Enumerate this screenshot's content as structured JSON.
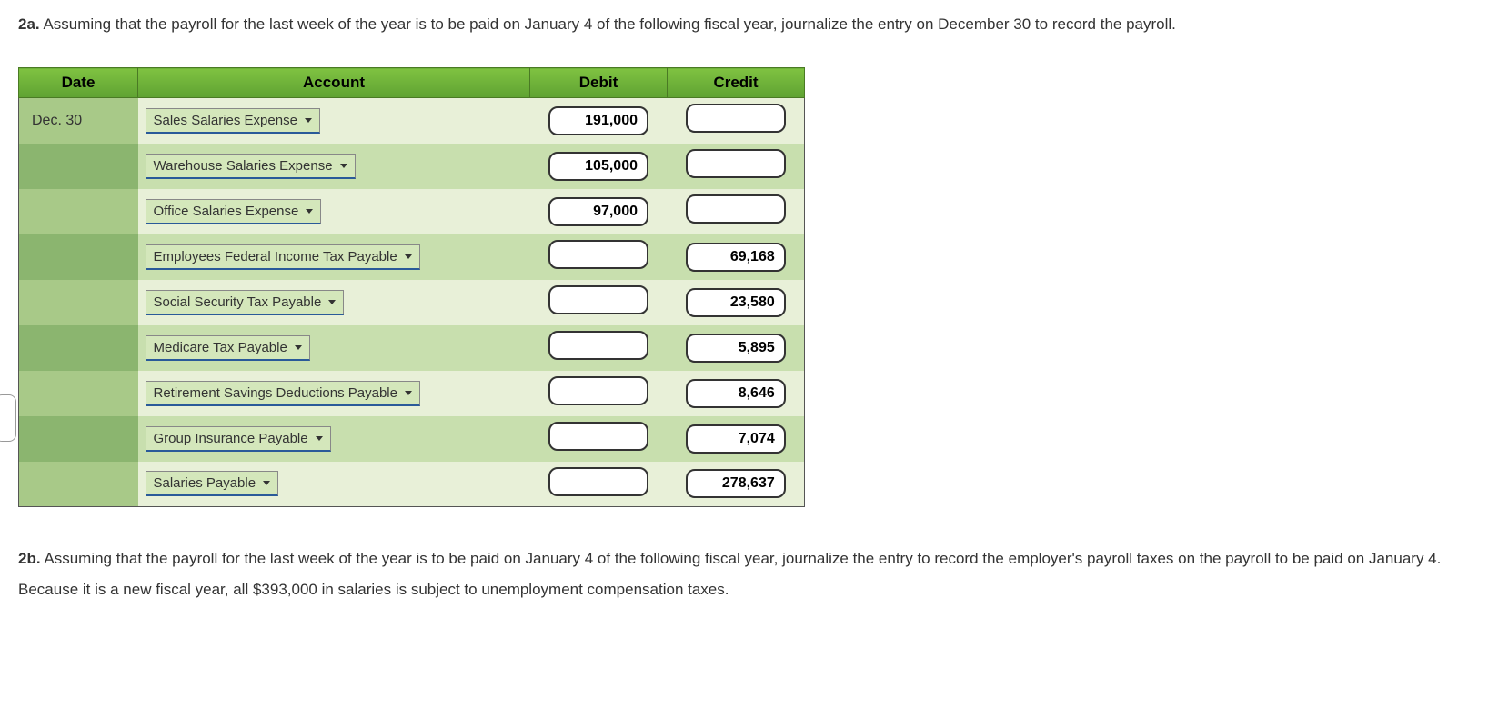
{
  "question2a": {
    "label": "2a.",
    "text": "Assuming that the payroll for the last week of the year is to be paid on January 4 of the following fiscal year, journalize the entry on December 30 to record the payroll."
  },
  "table": {
    "headers": {
      "date": "Date",
      "account": "Account",
      "debit": "Debit",
      "credit": "Credit"
    },
    "rows": [
      {
        "date": "Dec. 30",
        "account": "Sales Salaries Expense",
        "debit": "191,000",
        "credit": ""
      },
      {
        "date": "",
        "account": "Warehouse Salaries Expense",
        "debit": "105,000",
        "credit": ""
      },
      {
        "date": "",
        "account": "Office Salaries Expense",
        "debit": "97,000",
        "credit": ""
      },
      {
        "date": "",
        "account": "Employees Federal Income Tax Payable",
        "debit": "",
        "credit": "69,168"
      },
      {
        "date": "",
        "account": "Social Security Tax Payable",
        "debit": "",
        "credit": "23,580"
      },
      {
        "date": "",
        "account": "Medicare Tax Payable",
        "debit": "",
        "credit": "5,895"
      },
      {
        "date": "",
        "account": "Retirement Savings Deductions Payable",
        "debit": "",
        "credit": "8,646"
      },
      {
        "date": "",
        "account": "Group Insurance Payable",
        "debit": "",
        "credit": "7,074"
      },
      {
        "date": "",
        "account": "Salaries Payable",
        "debit": "",
        "credit": "278,637"
      }
    ]
  },
  "question2b": {
    "label": "2b.",
    "text": "Assuming that the payroll for the last week of the year is to be paid on January 4 of the following fiscal year, journalize the entry to record the employer's payroll taxes on the payroll to be paid on January 4. Because it is a new fiscal year, all $393,000 in salaries is subject to unemployment compensation taxes."
  }
}
